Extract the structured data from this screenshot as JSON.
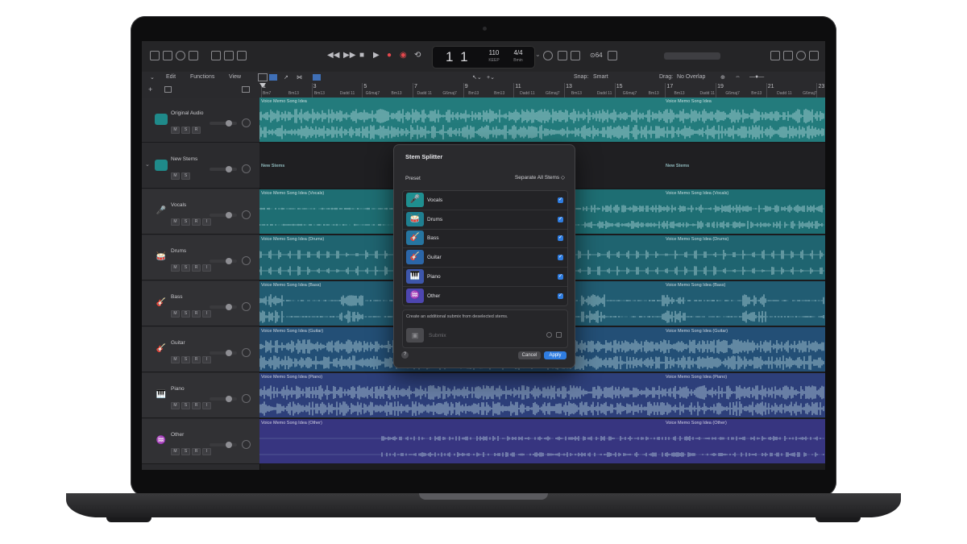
{
  "menu": {
    "edit": "Edit",
    "functions": "Functions",
    "view": "View",
    "snap_label": "Snap:",
    "snap_value": "Smart",
    "drag_label": "Drag:",
    "drag_value": "No Overlap"
  },
  "lcd": {
    "position": "1  1",
    "tempo": "110",
    "tempo_label": "KEEP",
    "signature": "4/4",
    "key": "Bmin"
  },
  "toolbar": {
    "count": "⊙64"
  },
  "ruler": {
    "bars": [
      "1",
      "3",
      "5",
      "7",
      "9",
      "11",
      "13",
      "15",
      "17",
      "19",
      "21",
      "23"
    ],
    "chords": [
      "Bm7",
      "Bm13",
      "Bm13",
      "Dadd 11",
      "G6maj7",
      "Bm13",
      "Dadd 11",
      "G6maj7",
      "Bm13",
      "Bm13",
      "Dadd 11",
      "G6maj7",
      "Bm13",
      "Dadd 11",
      "G6maj7",
      "Bm13",
      "Bm13",
      "Dadd 11",
      "G6maj7",
      "Bm13",
      "Dadd 11",
      "G6maj7"
    ]
  },
  "msr": {
    "m": "M",
    "s": "S",
    "r": "R",
    "i": "I"
  },
  "tracks": [
    {
      "name": "Original Audio",
      "color": "#1f8a8a",
      "region": "Voice Memo Song Idea",
      "region_color": "#237b7c",
      "type": "audio"
    },
    {
      "name": "New Stems",
      "color": "#1f8a8a",
      "region": "New Stems",
      "type": "folder"
    },
    {
      "name": "Vocals",
      "color": "#1f8a8a",
      "region": "Voice Memo Song Idea (Vocals)",
      "region_color": "#1e6e73",
      "type": "stem"
    },
    {
      "name": "Drums",
      "color": "#1f7a8a",
      "region": "Voice Memo Song Idea (Drums)",
      "region_color": "#1f6470",
      "type": "stem"
    },
    {
      "name": "Bass",
      "color": "#26708c",
      "region": "Voice Memo Song Idea (Bass)",
      "region_color": "#215c72",
      "type": "stem"
    },
    {
      "name": "Guitar",
      "color": "#2a6390",
      "region": "Voice Memo Song Idea (Guitar)",
      "region_color": "#234f76",
      "type": "stem"
    },
    {
      "name": "Piano",
      "color": "#3a4f92",
      "region": "Voice Memo Song Idea (Piano)",
      "region_color": "#2d3f7a",
      "type": "stem"
    },
    {
      "name": "Other",
      "color": "#4a4496",
      "region": "Voice Memo Song Idea (Other)",
      "region_color": "#373580",
      "type": "stem"
    }
  ],
  "dialog": {
    "title": "Stem Splitter",
    "preset_label": "Preset",
    "preset_value": "Separate All Stems ◇",
    "stems": [
      {
        "name": "Vocals",
        "color": "#1f8f90",
        "glyph": "🎤"
      },
      {
        "name": "Drums",
        "color": "#1f7f90",
        "glyph": "🥁"
      },
      {
        "name": "Bass",
        "color": "#2675a0",
        "glyph": "🎸"
      },
      {
        "name": "Guitar",
        "color": "#2b66a8",
        "glyph": "🎸"
      },
      {
        "name": "Piano",
        "color": "#3d56ab",
        "glyph": "🎹"
      },
      {
        "name": "Other",
        "color": "#4d46b0",
        "glyph": "♒"
      }
    ],
    "submix_note": "Create an additional submix from deselected stems.",
    "submix_name": "Submix",
    "help": "?",
    "cancel": "Cancel",
    "apply": "Apply",
    "check": "✓"
  }
}
